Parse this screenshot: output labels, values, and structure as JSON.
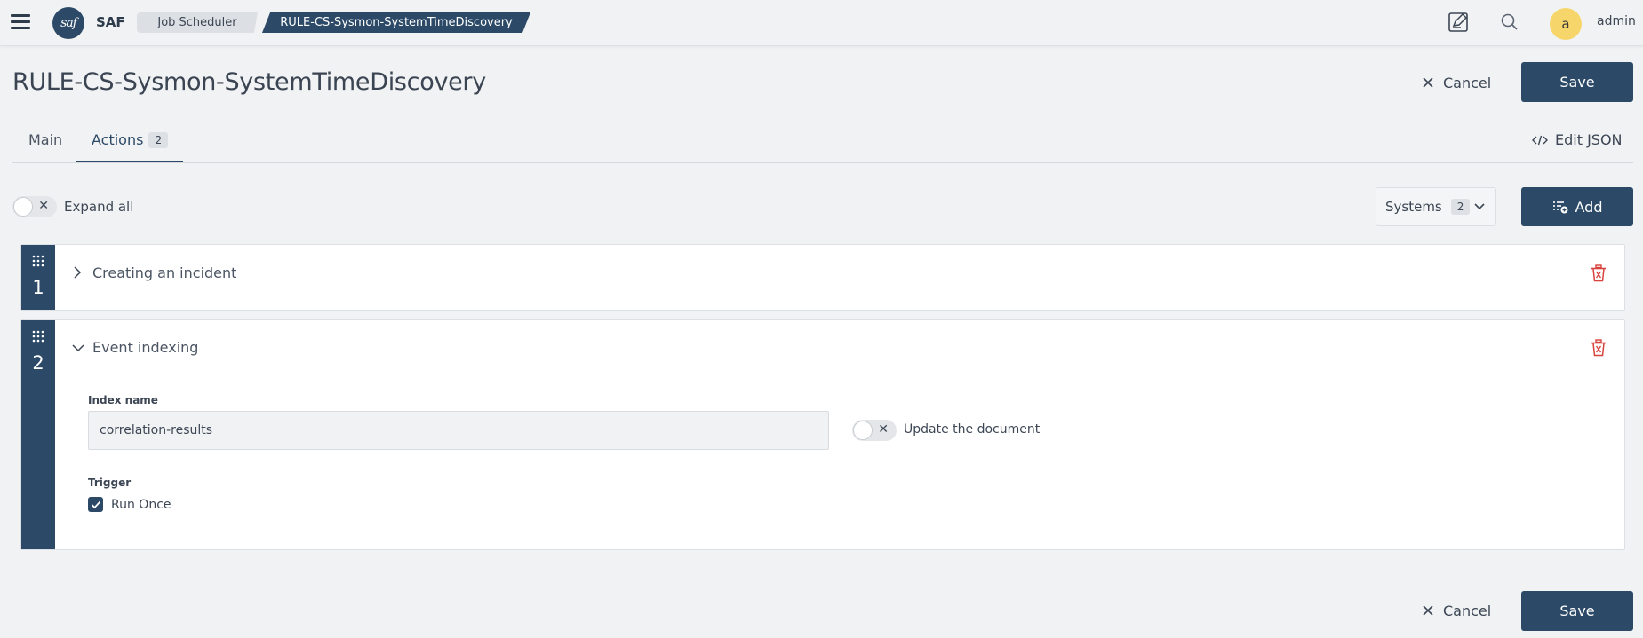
{
  "topbar": {
    "brand": "SAF",
    "logo_text": "saf",
    "breadcrumbs": [
      "Job Scheduler",
      "RULE-CS-Sysmon-SystemTimeDiscovery"
    ],
    "avatar_letter": "a",
    "username": "admin",
    "icons": [
      "menu-icon",
      "notes-icon",
      "search-icon"
    ]
  },
  "header": {
    "title": "RULE-CS-Sysmon-SystemTimeDiscovery",
    "cancel_label": "Cancel",
    "save_label": "Save"
  },
  "tabs": [
    {
      "label": "Main",
      "active": false
    },
    {
      "label": "Actions",
      "count": "2",
      "active": true
    }
  ],
  "edit_json_label": "Edit JSON",
  "toolbar": {
    "expand_all_label": "Expand all",
    "expand_all_on": false,
    "systems_label": "Systems",
    "systems_count": "2",
    "add_label": "Add"
  },
  "actions": [
    {
      "number": "1",
      "title": "Creating an incident",
      "expanded": false
    },
    {
      "number": "2",
      "title": "Event indexing",
      "expanded": true,
      "index_name_label": "Index name",
      "index_name_value": "correlation-results",
      "update_document_label": "Update the document",
      "update_document_on": false,
      "trigger_label": "Trigger",
      "run_once_label": "Run Once",
      "run_once_checked": true
    }
  ],
  "footer": {
    "cancel_label": "Cancel",
    "save_label": "Save"
  },
  "colors": {
    "primary": "#2c4a67",
    "background": "#f1f2f3",
    "danger": "#d9423c",
    "avatar": "#f6d66a"
  }
}
